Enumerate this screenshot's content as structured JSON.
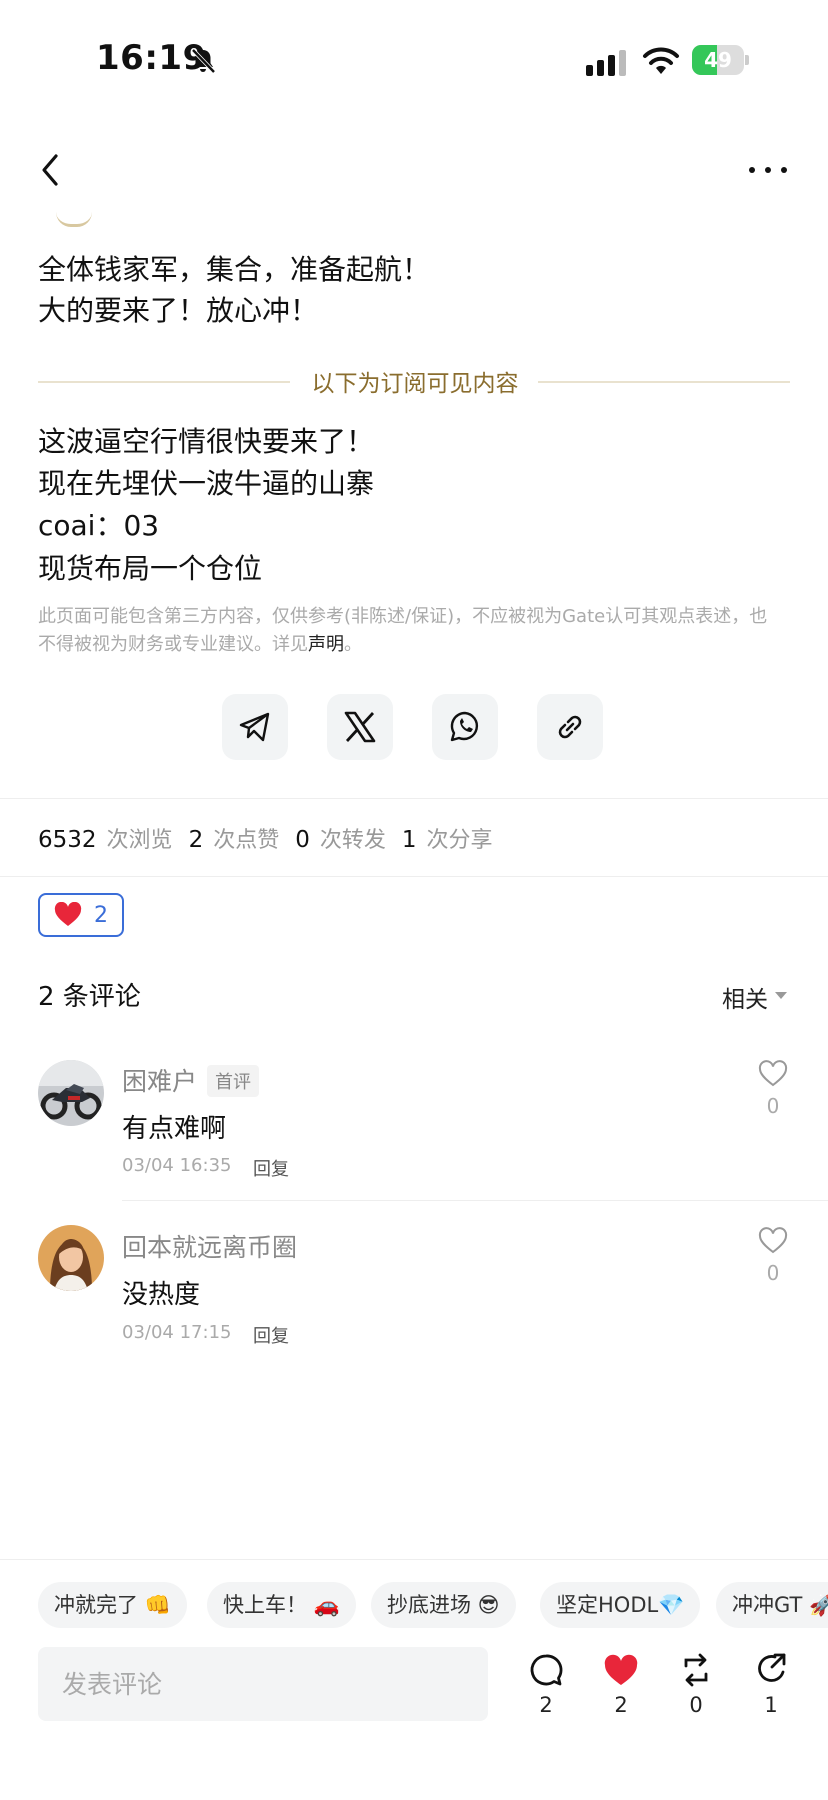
{
  "status_bar": {
    "time": "16:19",
    "battery": "49",
    "battery_level": 0.49
  },
  "post": {
    "lines": [
      "全体钱家军，集合，准备起航！",
      "大的要来了！放心冲！"
    ],
    "subscriber_divider": "以下为订阅可见内容",
    "sub_lines": [
      "这波逼空行情很快要来了！",
      "现在先埋伏一波牛逼的山寨",
      "coai：03",
      "现货布局一个仓位"
    ],
    "disclaimer": "此页面可能包含第三方内容，仅供参考(非陈述/保证)，不应被视为Gate认可其观点表述，也不得被视为财务或专业建议。详见",
    "disclaimer_link": "声明",
    "disclaimer_end": "。"
  },
  "share": {
    "icons": [
      "telegram-icon",
      "x-icon",
      "whatsapp-icon",
      "link-icon"
    ]
  },
  "stats": {
    "views": "6532",
    "views_label": "次浏览",
    "likes": "2",
    "likes_label": "次点赞",
    "reposts": "0",
    "reposts_label": "次转发",
    "shares": "1",
    "shares_label": "次分享"
  },
  "reaction": {
    "icon": "heart-icon",
    "count": "2"
  },
  "comments": {
    "title": "2 条评论",
    "sort": "相关",
    "items": [
      {
        "user": "困难户",
        "tag": "首评",
        "text": "有点难啊",
        "time": "03/04 16:35",
        "reply": "回复",
        "likes": "0"
      },
      {
        "user": "回本就远离币圈",
        "text": "没热度",
        "time": "03/04 17:15",
        "reply": "回复",
        "likes": "0"
      }
    ]
  },
  "quick_replies": [
    "冲就完了 👊",
    "快上车！ 🚗",
    "抄底进场 😎",
    "坚定HODL💎",
    "冲冲GT 🚀"
  ],
  "bottom_bar": {
    "placeholder": "发表评论",
    "comment_count": "2",
    "like_count": "2",
    "repost_count": "0",
    "share_count": "1"
  },
  "colors": {
    "accent_gold": "#8a6d2e",
    "like_red": "#e8263a",
    "chip_blue": "#3a6dd8",
    "battery_green": "#34c759"
  }
}
